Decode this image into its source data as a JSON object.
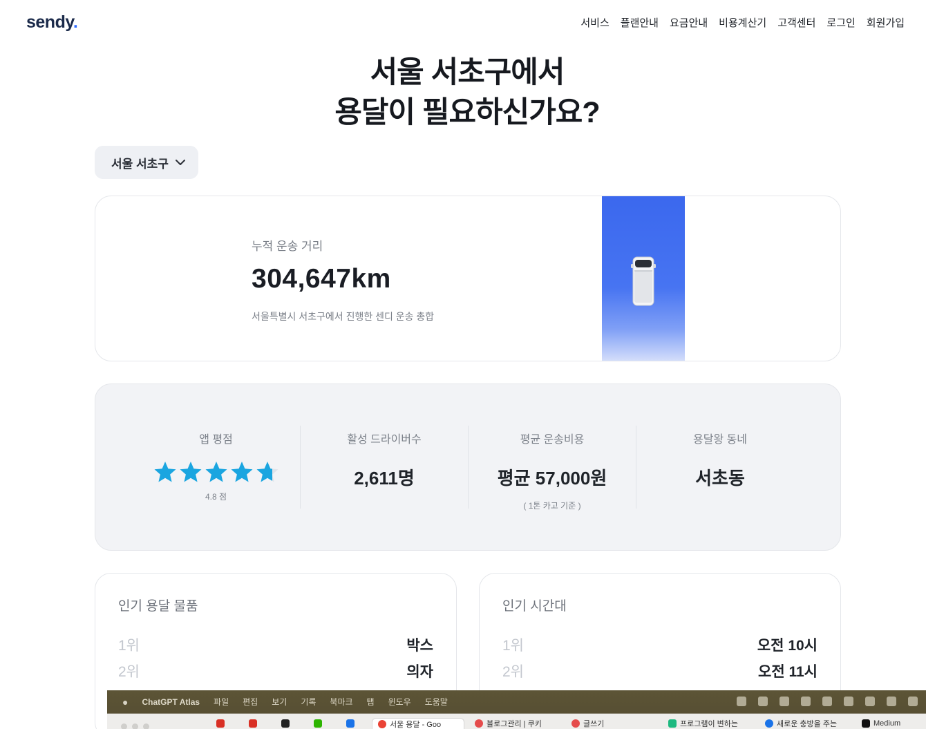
{
  "header": {
    "logo": "sendy",
    "logo_dot": ".",
    "nav": [
      "서비스",
      "플랜안내",
      "요금안내",
      "비용계산기",
      "고객센터",
      "로그인",
      "회원가입"
    ]
  },
  "hero": {
    "line1": "서울 서초구에서",
    "line2": "용달이 필요하신가요?"
  },
  "region_select": {
    "value": "서울 서초구"
  },
  "distance": {
    "label": "누적 운송 거리",
    "value": "304,647km",
    "description": "서울특별시 서초구에서 진행한 센디 운송 총합"
  },
  "stats": {
    "rating": {
      "label": "앱 평점",
      "score": 4.8,
      "max": 5,
      "score_text": "4.8 점"
    },
    "drivers": {
      "label": "활성 드라이버수",
      "value": "2,611명"
    },
    "cost": {
      "label": "평균 운송비용",
      "value": "평균 57,000원",
      "note": "( 1톤 카고 기준 )"
    },
    "area": {
      "label": "용달왕 동네",
      "value": "서초동"
    }
  },
  "popular_items": {
    "title": "인기 용달 물품",
    "rows": [
      {
        "rank": "1위",
        "value": "박스"
      },
      {
        "rank": "2위",
        "value": "의자"
      }
    ]
  },
  "popular_times": {
    "title": "인기 시간대",
    "rows": [
      {
        "rank": "1위",
        "value": "오전 10시"
      },
      {
        "rank": "2위",
        "value": "오전 11시"
      }
    ]
  },
  "os_menubar": {
    "app": "ChatGPT Atlas",
    "items": [
      "파일",
      "편집",
      "보기",
      "기록",
      "북마크",
      "탭",
      "윈도우",
      "도움말"
    ]
  },
  "browser_tabs": [
    "서울 용달 - Goo",
    "블로그관리 | 쿠키",
    "글쓰기",
    "프로그램이 변하는",
    "새로운 충방을 주는",
    "Medium"
  ],
  "colors": {
    "brand": "#1b2a4a",
    "accent": "#2f6bff",
    "road": "#3b68ee",
    "star": "#1aa5e0"
  }
}
